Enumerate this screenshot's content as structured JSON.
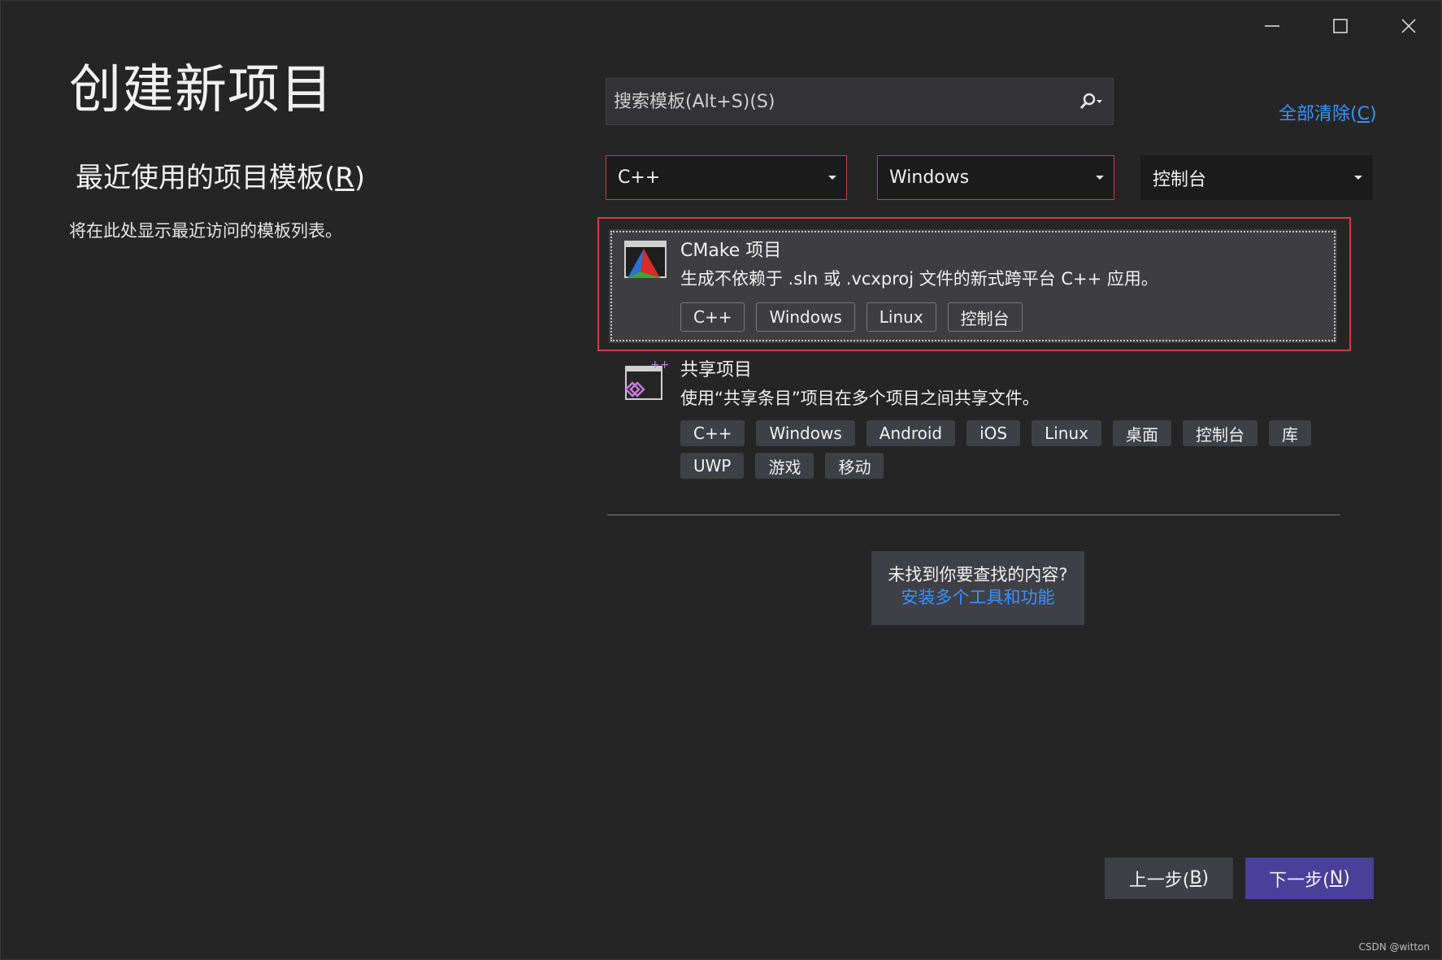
{
  "window": {
    "controls": [
      "minimize",
      "maximize",
      "close"
    ]
  },
  "left": {
    "title": "创建新项目",
    "recent_heading_prefix": "最近使用的项目模板(",
    "recent_heading_accel": "R",
    "recent_heading_suffix": ")",
    "recent_empty_text": "将在此处显示最近访问的模板列表。"
  },
  "search": {
    "placeholder": "搜索模板(Alt+S)(S)",
    "icon": "search-icon",
    "clear_all_prefix": "全部清除(",
    "clear_all_accel": "C",
    "clear_all_suffix": ")"
  },
  "filters": {
    "language": "C++",
    "platform": "Windows",
    "project_type": "控制台"
  },
  "templates": [
    {
      "name": "CMake 项目",
      "description": "生成不依赖于 .sln 或 .vcxproj 文件的新式跨平台 C++ 应用。",
      "tags": [
        "C++",
        "Windows",
        "Linux",
        "控制台"
      ],
      "icon": "cmake-icon"
    },
    {
      "name": "共享项目",
      "description": "使用“共享条目”项目在多个项目之间共享文件。",
      "tags_row1": [
        "C++",
        "Windows",
        "Android",
        "iOS",
        "Linux",
        "桌面",
        "控制台",
        "库"
      ],
      "tags_row2": [
        "UWP",
        "游戏",
        "移动"
      ],
      "icon": "shared-project-icon"
    }
  ],
  "not_found": {
    "text": "未找到你要查找的内容?",
    "link": "安装多个工具和功能"
  },
  "buttons": {
    "back_prefix": "上一步(",
    "back_accel": "B",
    "back_suffix": ")",
    "next_prefix": "下一步(",
    "next_accel": "N",
    "next_suffix": ")"
  },
  "watermark": "CSDN @witton",
  "colors": {
    "background": "#252526",
    "accent_link": "#3794ff",
    "next_button": "#4b3f9a",
    "highlight_border": "#e5343b"
  }
}
